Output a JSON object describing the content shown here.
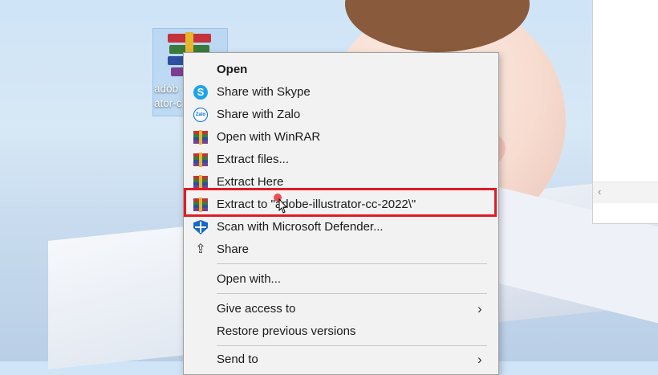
{
  "desktop_icon": {
    "label_line1": "adob",
    "label_line2": "ator-c"
  },
  "context_menu": {
    "items": [
      {
        "label": "Open",
        "icon": "none",
        "bold": true
      },
      {
        "label": "Share with Skype",
        "icon": "skype-icon"
      },
      {
        "label": "Share with Zalo",
        "icon": "zalo-icon"
      },
      {
        "label": "Open with WinRAR",
        "icon": "winrar-icon"
      },
      {
        "label": "Extract files...",
        "icon": "winrar-icon"
      },
      {
        "label": "Extract Here",
        "icon": "winrar-icon"
      },
      {
        "label": "Extract to \"adobe-illustrator-cc-2022\\\"",
        "icon": "winrar-icon",
        "highlighted": true
      },
      {
        "label": "Scan with Microsoft Defender...",
        "icon": "defender-icon"
      },
      {
        "label": "Share",
        "icon": "share-icon"
      },
      {
        "label": "Open with...",
        "icon": "none"
      },
      {
        "label": "Give access to",
        "icon": "none",
        "submenu": true
      },
      {
        "label": "Restore previous versions",
        "icon": "none"
      },
      {
        "label": "Send to",
        "icon": "none",
        "submenu": true
      }
    ],
    "zalo_icon_text": "Zalo",
    "skype_icon_text": "S"
  },
  "side_window": {
    "scroll_left_glyph": "‹"
  },
  "colors": {
    "highlight_border": "#e01b24",
    "menu_background": "#f2f2f2",
    "skype_blue": "#1fa3e8",
    "defender_blue": "#1668c4"
  }
}
